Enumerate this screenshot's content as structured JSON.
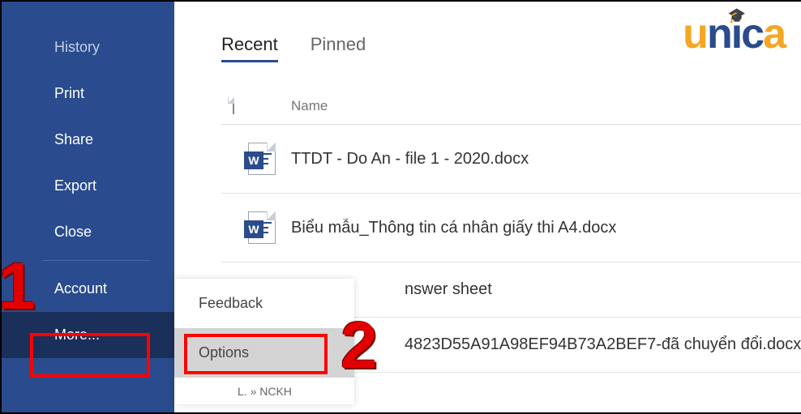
{
  "brand": {
    "letters": [
      "u",
      "n",
      "i",
      "c",
      "a"
    ]
  },
  "sidebar": {
    "items": [
      {
        "label": "History",
        "class": "history"
      },
      {
        "label": "Print"
      },
      {
        "label": "Share"
      },
      {
        "label": "Export"
      },
      {
        "label": "Close"
      },
      {
        "label": "Account"
      },
      {
        "label": "More...",
        "class": "more"
      }
    ]
  },
  "tabs": [
    {
      "label": "Recent",
      "active": true
    },
    {
      "label": "Pinned",
      "active": false
    }
  ],
  "list_header": {
    "name_col": "Name"
  },
  "files": [
    {
      "name": "TTDT - Do An - file 1 - 2020.docx"
    },
    {
      "name": "Biểu mẫu_Thông tin cá nhân giấy thi A4.docx"
    },
    {
      "name_fragment": "nswer sheet"
    },
    {
      "name": "4823D55A91A98EF94B73A2BEF7-đã chuyển đổi.docx",
      "remnant": "L. » NCKH"
    }
  ],
  "popup": {
    "items": [
      {
        "label": "Feedback",
        "selected": false
      },
      {
        "label": "Options",
        "selected": true
      }
    ],
    "remnant": "L. » NCKH"
  },
  "markers": {
    "m1": "1",
    "m2": "2"
  }
}
